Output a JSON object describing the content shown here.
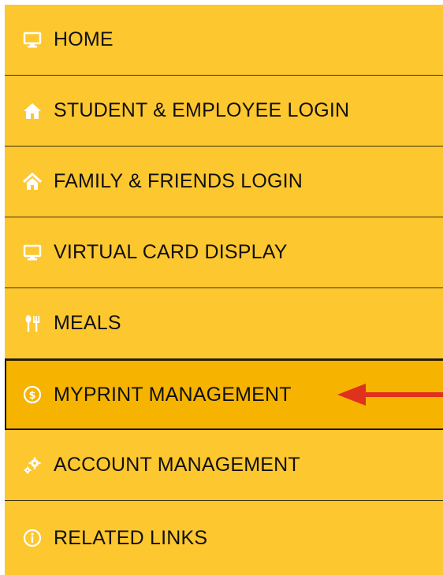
{
  "menu": {
    "items": [
      {
        "label": "HOME",
        "icon": "monitor-icon"
      },
      {
        "label": "STUDENT & EMPLOYEE LOGIN",
        "icon": "house-filled-icon"
      },
      {
        "label": "FAMILY & FRIENDS LOGIN",
        "icon": "house-outline-icon"
      },
      {
        "label": "VIRTUAL CARD DISPLAY",
        "icon": "monitor-icon"
      },
      {
        "label": "MEALS",
        "icon": "utensils-icon"
      },
      {
        "label": "MYPRINT MANAGEMENT",
        "icon": "dollar-circle-icon",
        "active": true
      },
      {
        "label": "ACCOUNT MANAGEMENT",
        "icon": "gears-icon"
      },
      {
        "label": "RELATED LINKS",
        "icon": "info-circle-icon"
      }
    ],
    "annotation": "red-arrow-pointing-left"
  },
  "colors": {
    "menu_background": "#fdc72f",
    "active_background": "#f6b400",
    "text": "#111111",
    "divider": "#3d3312",
    "arrow": "#e0301e"
  }
}
